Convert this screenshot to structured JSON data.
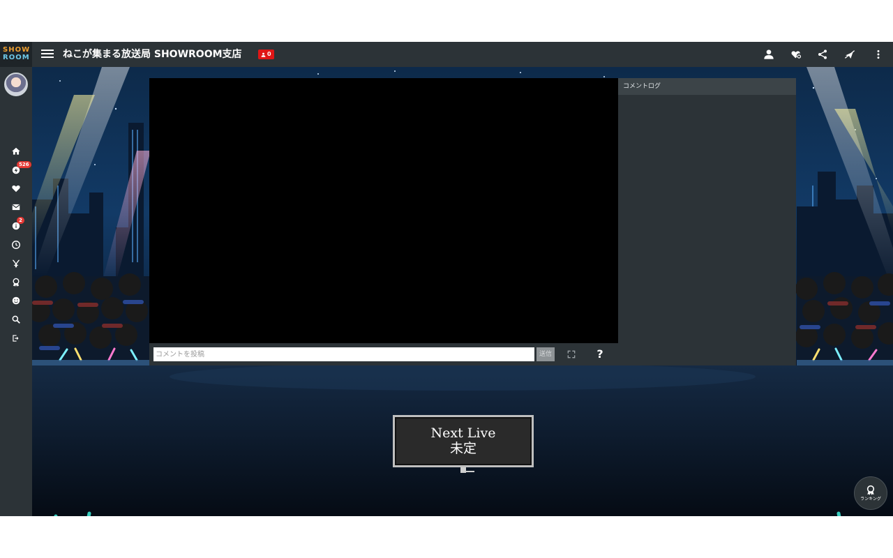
{
  "logo": {
    "line1": "SHOW",
    "line2": "ROOM"
  },
  "header": {
    "title": "ねこが集まる放送局 SHOWROOM支店",
    "viewer_count": "0",
    "icons": [
      "user-icon",
      "heart-settings-icon",
      "share-icon",
      "mute-icon",
      "more-vert-icon"
    ]
  },
  "sidebar": {
    "items": [
      {
        "name": "home-icon"
      },
      {
        "name": "live-icon",
        "badge": "526"
      },
      {
        "name": "heart-icon"
      },
      {
        "name": "mail-icon"
      },
      {
        "name": "info-icon",
        "badge": "2"
      },
      {
        "name": "history-icon"
      },
      {
        "name": "event-icon"
      },
      {
        "name": "ranking-icon"
      },
      {
        "name": "smile-icon"
      },
      {
        "name": "search-icon"
      },
      {
        "name": "logout-icon"
      }
    ]
  },
  "player": {
    "comment_placeholder": "コメントを投稿",
    "send_label": "送信",
    "help_label": "?"
  },
  "comment_log": {
    "title": "コメントログ"
  },
  "next_live": {
    "line1": "Next Live",
    "line2": "未定"
  },
  "ranking": {
    "label": "ランキング"
  }
}
